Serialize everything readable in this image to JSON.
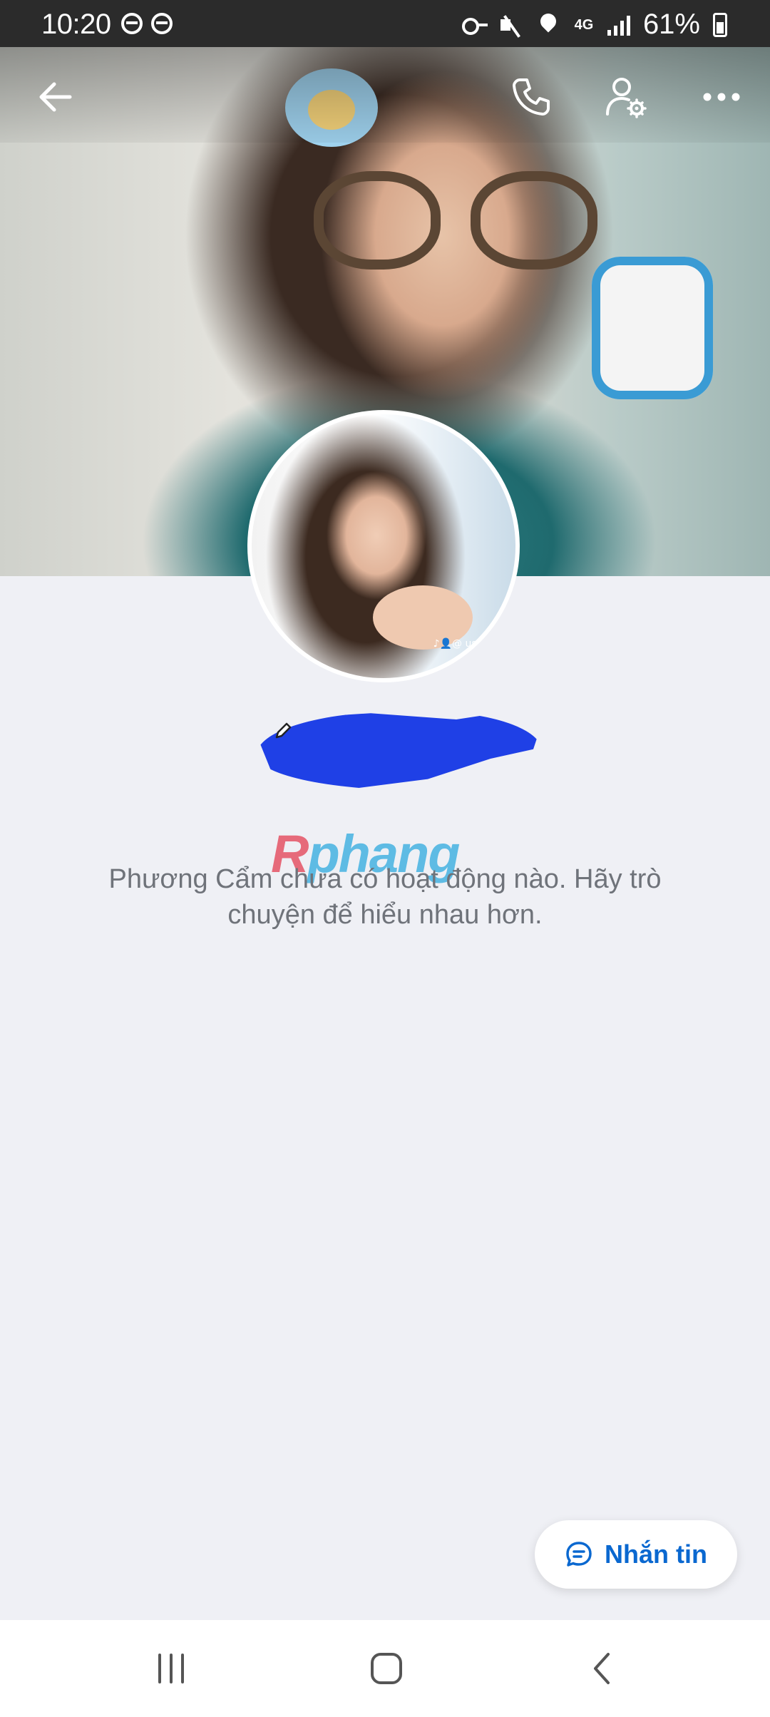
{
  "status_bar": {
    "time": "10:20",
    "network": "4G",
    "battery": "61%",
    "left_icons": [
      "steering-wheel-icon",
      "steering-wheel-icon"
    ],
    "right_icons": [
      "key-icon",
      "mute-icon",
      "location-icon",
      "network-4g-icon",
      "signal-icon",
      "battery-icon"
    ]
  },
  "top_bar": {
    "icons": [
      "back-arrow-icon",
      "phone-icon",
      "user-settings-icon",
      "more-icon"
    ]
  },
  "profile": {
    "avatar_tag": "♪👤@ user",
    "name": ""
  },
  "watermark": {
    "part1": "R",
    "part2": "phang"
  },
  "empty_state": {
    "message": "Phương Cẩm chưa có hoạt động nào. Hãy trò chuyện để hiểu nhau hơn."
  },
  "message_button": {
    "label": "Nhắn tin",
    "icon": "chat-bubble-icon",
    "color": "#0a68d0"
  },
  "nav_bar": {
    "icons": [
      "recent-apps-icon",
      "home-icon",
      "back-icon"
    ]
  }
}
